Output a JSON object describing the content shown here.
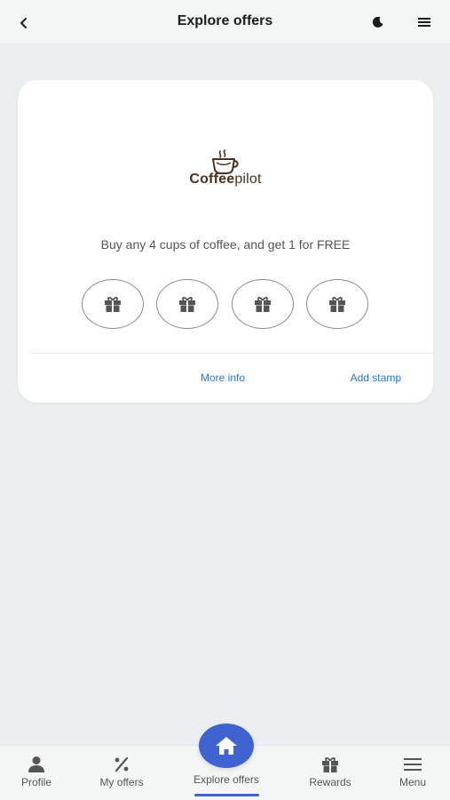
{
  "header": {
    "title": "Explore offers",
    "back_icon": "chevron-left-icon",
    "theme_icon": "moon-icon",
    "menu_icon": "hamburger-icon"
  },
  "offer_card": {
    "brand_prefix": "Coffee",
    "brand_suffix": "pilot",
    "description": "Buy any 4 cups of coffee, and get 1 for FREE",
    "stamps": [
      {
        "icon": "gift-icon",
        "filled": false
      },
      {
        "icon": "gift-icon",
        "filled": false
      },
      {
        "icon": "gift-icon",
        "filled": false
      },
      {
        "icon": "gift-icon",
        "filled": false
      }
    ],
    "more_info_label": "More info",
    "add_stamp_label": "Add stamp"
  },
  "tabbar": {
    "items": [
      {
        "label": "Profile",
        "icon": "person-icon"
      },
      {
        "label": "My offers",
        "icon": "percent-icon"
      },
      {
        "label": "Explore offers",
        "icon": "home-icon",
        "active": true
      },
      {
        "label": "Rewards",
        "icon": "gift-icon"
      },
      {
        "label": "Menu",
        "icon": "hamburger-icon"
      }
    ]
  },
  "colors": {
    "accent": "#3f63d0",
    "link": "#2f73d8",
    "brand_brown": "#4a3222",
    "background": "#eceff0"
  }
}
